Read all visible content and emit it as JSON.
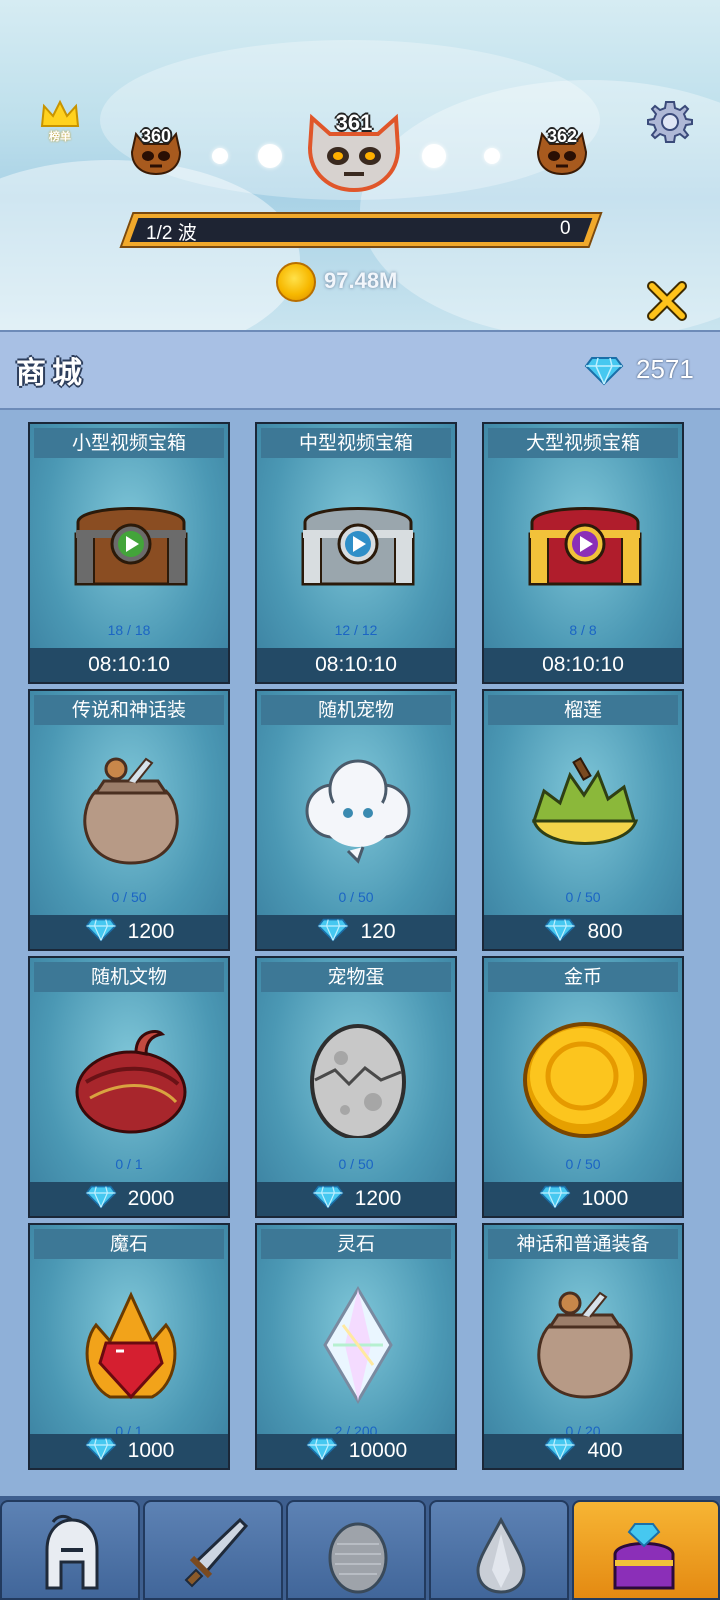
{
  "header": {
    "crown_label": "榜单",
    "waves": {
      "prev": "360",
      "current": "361",
      "next": "362"
    },
    "progress_label": "1/2 波",
    "progress_value": "0",
    "gold": "97.48M"
  },
  "shop": {
    "title": "商城",
    "gems": "2571"
  },
  "items": [
    {
      "title": "小型视频宝箱",
      "count": "18 / 18",
      "price": "08:10:10",
      "price_type": "timer",
      "icon": "small-video-chest"
    },
    {
      "title": "中型视频宝箱",
      "count": "12 / 12",
      "price": "08:10:10",
      "price_type": "timer",
      "icon": "medium-video-chest"
    },
    {
      "title": "大型视频宝箱",
      "count": "8 / 8",
      "price": "08:10:10",
      "price_type": "timer",
      "icon": "large-video-chest"
    },
    {
      "title": "传说和神话装",
      "count": "0 / 50",
      "price": "1200",
      "price_type": "gem",
      "icon": "loot-sack"
    },
    {
      "title": "随机宠物",
      "count": "0 / 50",
      "price": "120",
      "price_type": "gem",
      "icon": "cloud-pet"
    },
    {
      "title": "榴莲",
      "count": "0 / 50",
      "price": "800",
      "price_type": "gem",
      "icon": "durian"
    },
    {
      "title": "随机文物",
      "count": "0 / 1",
      "price": "2000",
      "price_type": "gem",
      "icon": "relic-turban"
    },
    {
      "title": "宠物蛋",
      "count": "0 / 50",
      "price": "1200",
      "price_type": "gem",
      "icon": "pet-egg"
    },
    {
      "title": "金币",
      "count": "0 / 50",
      "price": "1000",
      "price_type": "gem",
      "icon": "gold-coin"
    },
    {
      "title": "魔石",
      "count": "0 / 1",
      "price": "1000",
      "price_type": "gem",
      "icon": "magic-stone"
    },
    {
      "title": "灵石",
      "count": "2 / 200",
      "price": "10000",
      "price_type": "gem",
      "icon": "spirit-stone"
    },
    {
      "title": "神话和普通装备",
      "count": "0 / 20",
      "price": "400",
      "price_type": "gem",
      "icon": "loot-sack"
    }
  ],
  "nav": [
    {
      "icon": "helmet-icon"
    },
    {
      "icon": "sword-icon"
    },
    {
      "icon": "egg-icon"
    },
    {
      "icon": "gem-drop-icon"
    },
    {
      "icon": "treasure-chest-icon",
      "active": true
    }
  ],
  "colors": {
    "gem": "#46c8f0",
    "gold": "#f7b800",
    "accent": "#f1a92b",
    "card": "#4b98b4"
  }
}
